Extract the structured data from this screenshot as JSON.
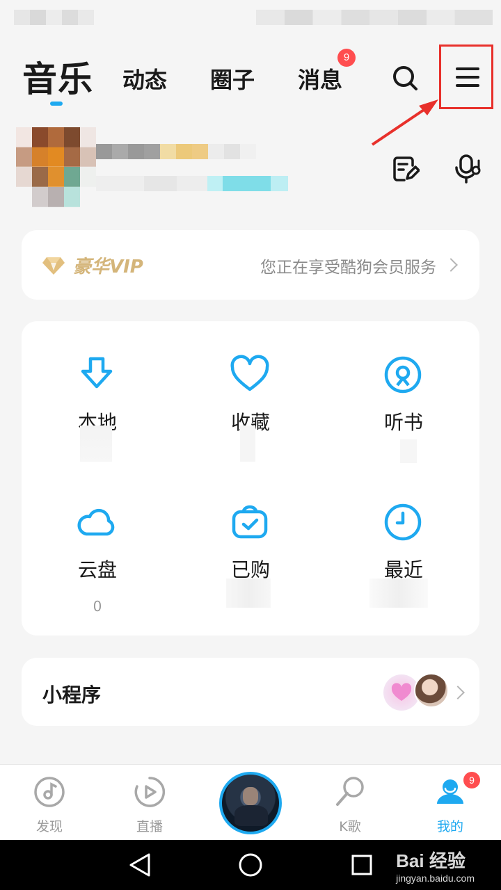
{
  "tabs": {
    "music": "音乐",
    "dynamics": "动态",
    "circle": "圈子",
    "messages": "消息",
    "messages_badge": "9"
  },
  "vip": {
    "badge_label": "豪华VIP",
    "description": "您正在享受酷狗会员服务"
  },
  "grid": {
    "items": [
      {
        "label": "本地",
        "icon": "download-icon"
      },
      {
        "label": "收藏",
        "icon": "heart-icon"
      },
      {
        "label": "听书",
        "icon": "audiobook-icon"
      },
      {
        "label": "云盘",
        "icon": "cloud-icon",
        "count": "0"
      },
      {
        "label": "已购",
        "icon": "purchased-bag-icon"
      },
      {
        "label": "最近",
        "icon": "clock-icon"
      }
    ]
  },
  "mini_program": {
    "title": "小程序"
  },
  "bottom_nav": {
    "items": [
      {
        "label": "发现",
        "icon": "discover-music-icon"
      },
      {
        "label": "直播",
        "icon": "live-play-icon"
      },
      {
        "label": "",
        "icon": "now-playing-cover"
      },
      {
        "label": "K歌",
        "icon": "microphone-icon"
      },
      {
        "label": "我的",
        "icon": "profile-icon"
      }
    ],
    "profile_badge": "9"
  },
  "watermark": {
    "main": "Bai 经验",
    "sub": "jingyan.baidu.com"
  },
  "colors": {
    "accent": "#1ea9f0",
    "badge": "#ff4d4f",
    "highlight": "#e8302b",
    "vip_gold": "#d4b57a"
  }
}
